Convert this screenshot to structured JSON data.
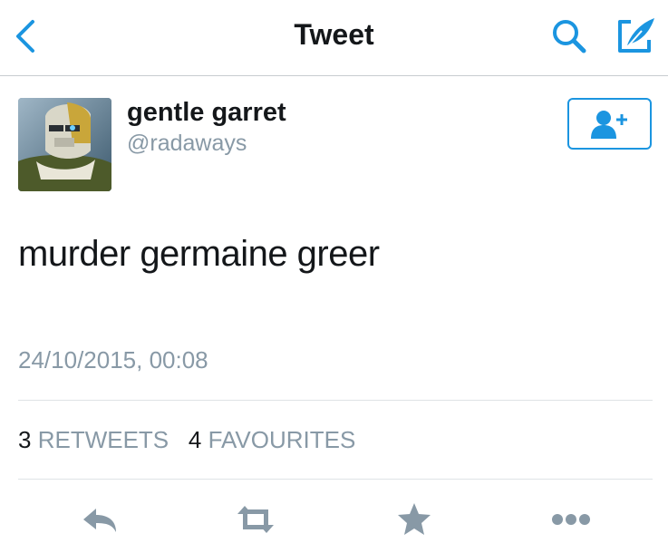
{
  "header": {
    "title": "Tweet",
    "icons": [
      "back-chevron",
      "search",
      "compose"
    ]
  },
  "tweet": {
    "display_name": "gentle garret",
    "handle": "@radaways",
    "text": "murder germaine greer",
    "timestamp": "24/10/2015, 00:08"
  },
  "stats": {
    "retweets_count": "3",
    "retweets_label": "RETWEETS",
    "favourites_count": "4",
    "favourites_label": "FAVOURITES"
  },
  "actions": [
    "reply",
    "retweet",
    "favourite",
    "more"
  ],
  "colors": {
    "accent": "#1b95e0",
    "secondary_text": "#8899a6",
    "primary_text": "#14171a",
    "action_icon": "#8899a6"
  }
}
